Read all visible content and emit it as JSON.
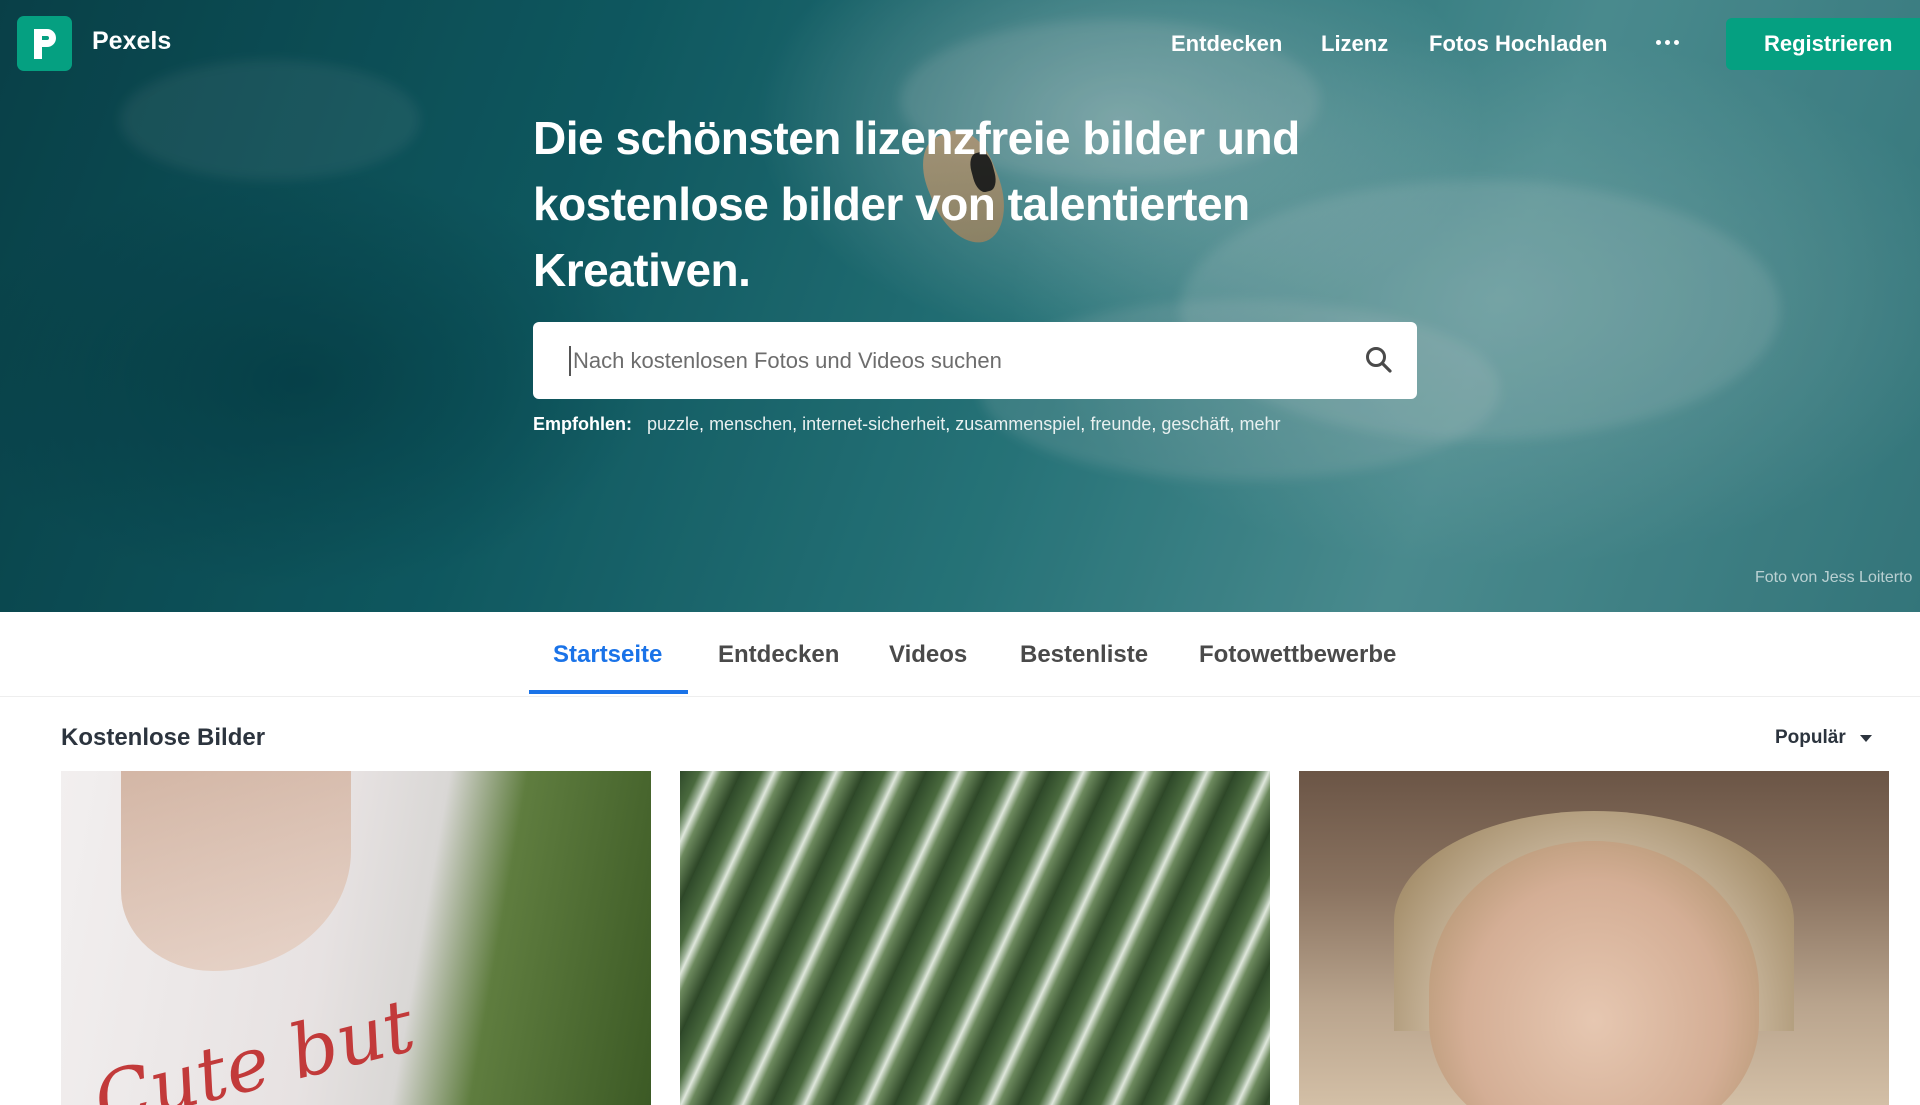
{
  "brand": {
    "name": "Pexels",
    "logo_letter": "P",
    "accent_color": "#05a081"
  },
  "nav": {
    "links": [
      "Entdecken",
      "Lizenz",
      "Fotos Hochladen"
    ],
    "more_icon": "more-dots-icon",
    "join_label": "Registrieren"
  },
  "hero": {
    "headline": "Die schönsten lizenzfreie bilder und kostenlose bilder von talentierten Kreativen.",
    "search_placeholder": "Nach kostenlosen Fotos und Videos suchen",
    "search_icon": "search-icon",
    "suggested_label": "Empfohlen:",
    "suggested_tags": [
      "puzzle",
      "menschen",
      "internet-sicherheit",
      "zusammenspiel",
      "freunde",
      "geschäft",
      "mehr"
    ],
    "photo_credit": "Foto von Jess Loiterto"
  },
  "tabs": {
    "items": [
      "Startseite",
      "Entdecken",
      "Videos",
      "Bestenliste",
      "Fotowettbewerbe"
    ],
    "active": "Startseite",
    "active_color": "#1a73e8"
  },
  "gallery": {
    "title": "Kostenlose Bilder",
    "sort_label": "Populär",
    "photo1_text": "Cute but"
  }
}
